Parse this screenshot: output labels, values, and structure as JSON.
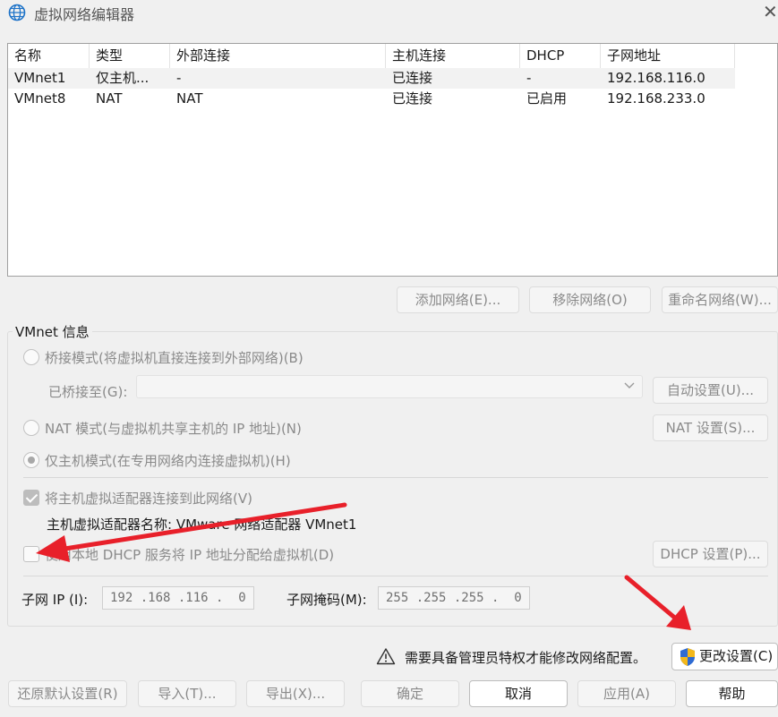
{
  "window": {
    "title": "虚拟网络编辑器",
    "icon": "globe-icon",
    "close_glyph": "✕"
  },
  "network_list": {
    "columns": [
      "名称",
      "类型",
      "外部连接",
      "主机连接",
      "DHCP",
      "子网地址"
    ],
    "rows": [
      [
        "VMnet1",
        "仅主机...",
        "-",
        "已连接",
        "-",
        "192.168.116.0"
      ],
      [
        "VMnet8",
        "NAT",
        "NAT",
        "已连接",
        "已启用",
        "192.168.233.0"
      ]
    ],
    "selected_row": 0
  },
  "list_buttons": {
    "add": "添加网络(E)...",
    "remove": "移除网络(O)",
    "rename": "重命名网络(W)..."
  },
  "vmnet_info": {
    "group_label": "VMnet 信息",
    "bridged_label": "桥接模式(将虚拟机直接连接到外部网络)(B)",
    "bridged_to_label": "已桥接至(G):",
    "bridged_to_value": "",
    "auto_settings_button": "自动设置(U)...",
    "nat_label": "NAT 模式(与虚拟机共享主机的 IP 地址)(N)",
    "nat_settings_button": "NAT 设置(S)...",
    "host_only_label": "仅主机模式(在专用网络内连接虚拟机)(H)",
    "selected_mode": "host_only",
    "connect_adapter_label": "将主机虚拟适配器连接到此网络(V)",
    "connect_adapter_checked": true,
    "adapter_name_label": "主机虚拟适配器名称: VMware 网络适配器 VMnet1",
    "dhcp_label": "使用本地 DHCP 服务将 IP 地址分配给虚拟机(D)",
    "dhcp_checked": false,
    "dhcp_settings_button": "DHCP 设置(P)...",
    "subnet_ip_label": "子网 IP (I):",
    "subnet_ip_value": "192 .168 .116 .  0",
    "subnet_mask_label": "子网掩码(M):",
    "subnet_mask_value": "255 .255 .255 .  0"
  },
  "admin_notice": {
    "text": "需要具备管理员特权才能修改网络配置。",
    "icon": "warning-icon"
  },
  "change_settings_button": {
    "label": "更改设置(C)",
    "icon": "uac-shield-icon"
  },
  "bottom_buttons": {
    "restore_defaults": "还原默认设置(R)",
    "import": "导入(T)...",
    "export": "导出(X)...",
    "ok": "确定",
    "cancel": "取消",
    "apply": "应用(A)",
    "help": "帮助"
  },
  "colors": {
    "annotation_arrow": "#e8202a",
    "shield_blue": "#2e6bd3",
    "shield_yellow": "#f3b81c"
  }
}
